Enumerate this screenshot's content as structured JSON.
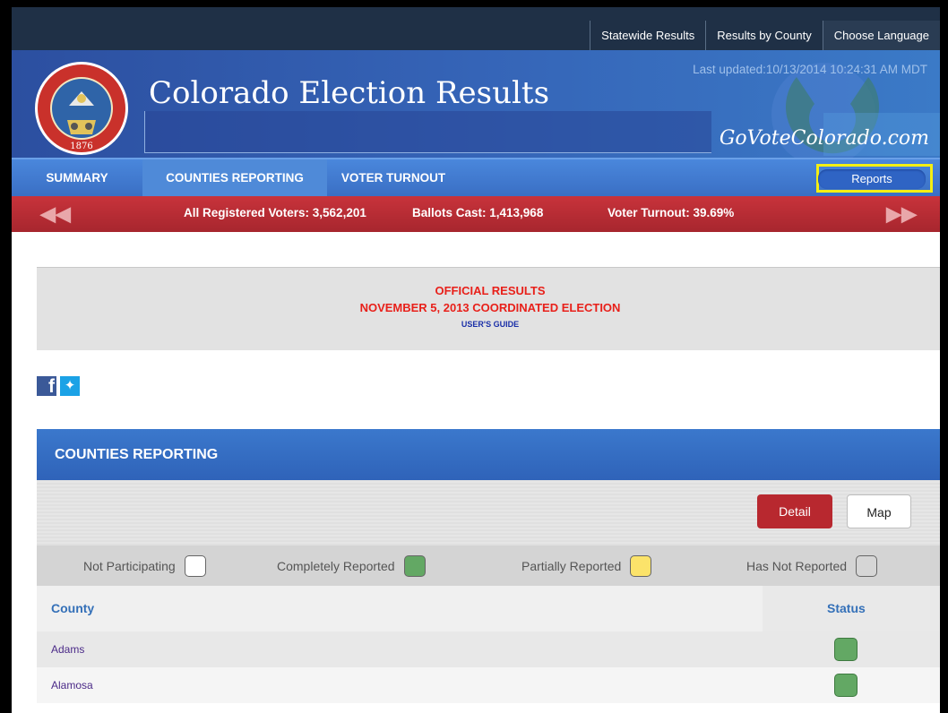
{
  "topnav": {
    "links": [
      "Statewide Results",
      "Results by County",
      "Choose Language"
    ]
  },
  "header": {
    "title": "Colorado Election Results",
    "last_updated": "Last updated:10/13/2014 10:24:31 AM MDT",
    "brand": "GoVoteColorado.com",
    "seal_year": "1876",
    "seal_text": "STATE OF COLORADO"
  },
  "nav": {
    "tabs": [
      "SUMMARY",
      "COUNTIES REPORTING",
      "VOTER TURNOUT"
    ],
    "active_tab": "COUNTIES REPORTING",
    "reports_label": "Reports"
  },
  "stats": {
    "registered": "All Registered Voters: 3,562,201",
    "ballots": "Ballots Cast: 1,413,968",
    "turnout": "Voter Turnout: 39.69%"
  },
  "official": {
    "line1": "OFFICIAL RESULTS",
    "line2": "NOVEMBER 5, 2013 COORDINATED ELECTION",
    "guide": "USER'S GUIDE"
  },
  "social": {
    "facebook": "f",
    "twitter": "t"
  },
  "panel": {
    "title": "COUNTIES REPORTING",
    "detail_label": "Detail",
    "map_label": "Map",
    "legend": [
      {
        "label": "Not Participating",
        "color": "#ffffff"
      },
      {
        "label": "Completely Reported",
        "color": "#63a864"
      },
      {
        "label": "Partially Reported",
        "color": "#fbe36a"
      },
      {
        "label": "Has Not Reported",
        "color": "#d6d6d6"
      }
    ],
    "col_county": "County",
    "col_status": "Status",
    "rows": [
      {
        "county": "Adams",
        "status": "Completely Reported"
      },
      {
        "county": "Alamosa",
        "status": "Completely Reported"
      }
    ]
  }
}
